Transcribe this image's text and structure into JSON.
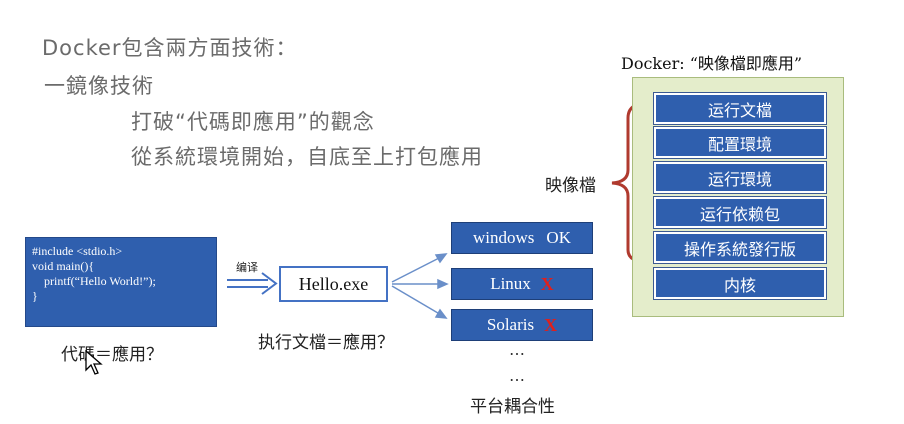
{
  "headings": {
    "line1": "Docker包含兩方面技術：",
    "line2": "一鏡像技術",
    "line3": "打破“代碼即應用”的觀念",
    "line4": "從系統環境開始，自底至上打包應用"
  },
  "code": {
    "text": "#include <stdio.h>\nvoid main(){\n    printf(“Hello World!”);\n}",
    "caption": "代碼＝應用？"
  },
  "compile_label": "编译",
  "exe": {
    "name": "Hello.exe",
    "caption": "执行文檔＝應用？"
  },
  "platforms": [
    {
      "name": "windows",
      "status": "OK"
    },
    {
      "name": "Linux",
      "status": "X"
    },
    {
      "name": "Solaris",
      "status": "X"
    }
  ],
  "platform_ellipsis_1": "…",
  "platform_ellipsis_2": "…",
  "platform_caption": "平台耦合性",
  "docker_panel": {
    "title": "Docker: “映像檔即應用”",
    "bracket_label": "映像檔",
    "layers": [
      "运行文檔",
      "配置環境",
      "运行環境",
      "运行依赖包",
      "操作系統發行版",
      "内核"
    ]
  },
  "colors": {
    "box_blue": "#2f5fae",
    "panel_green": "#e4edcb",
    "bracket_red": "#b03a2e",
    "x_red": "#e0201c"
  }
}
